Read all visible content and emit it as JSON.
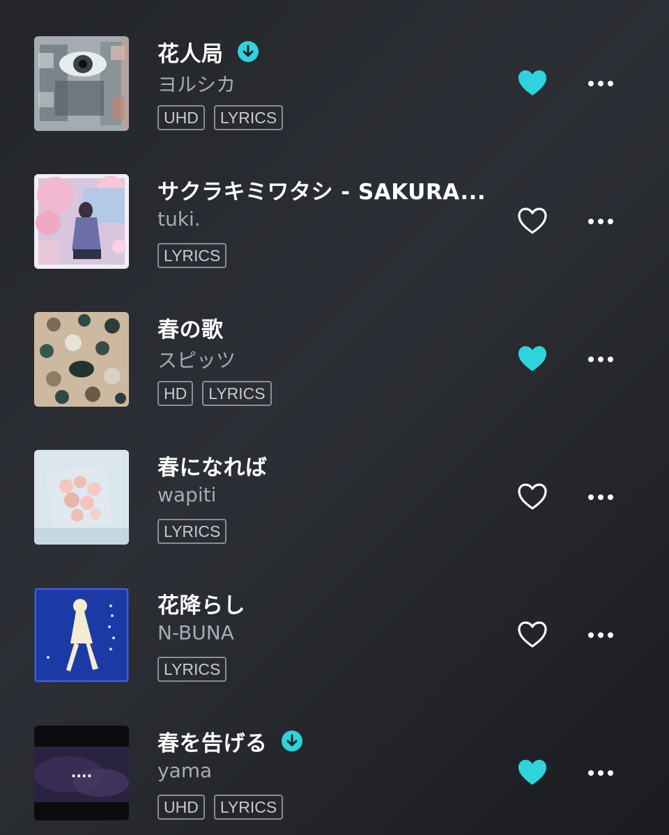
{
  "colors": {
    "accent": "#2fd3dc",
    "background": "#25272c",
    "secondary_text": "#a9acb2",
    "badge_border": "#8b8e94"
  },
  "tracks": [
    {
      "title": "花人局",
      "artist": "ヨルシカ",
      "downloaded": true,
      "favorited": true,
      "badges": [
        "UHD",
        "LYRICS"
      ],
      "art_icon": "album-art-ka-nin-kyoku"
    },
    {
      "title": "サクラキミワタシ - SAKURA...",
      "artist": "tuki.",
      "downloaded": false,
      "favorited": false,
      "badges": [
        "LYRICS"
      ],
      "art_icon": "album-art-sakura"
    },
    {
      "title": "春の歌",
      "artist": "スピッツ",
      "downloaded": false,
      "favorited": true,
      "badges": [
        "HD",
        "LYRICS"
      ],
      "art_icon": "album-art-haru-no-uta"
    },
    {
      "title": "春になれば",
      "artist": "wapiti",
      "downloaded": false,
      "favorited": false,
      "badges": [
        "LYRICS"
      ],
      "art_icon": "album-art-haru-ni-nareba"
    },
    {
      "title": "花降らし",
      "artist": "N-BUNA",
      "downloaded": false,
      "favorited": false,
      "badges": [
        "LYRICS"
      ],
      "art_icon": "album-art-hanafurashi"
    },
    {
      "title": "春を告げる",
      "artist": "yama",
      "downloaded": true,
      "favorited": true,
      "badges": [
        "UHD",
        "LYRICS"
      ],
      "art_icon": "album-art-haru-wo-tsugeru",
      "art_overlay_text": "...."
    }
  ]
}
